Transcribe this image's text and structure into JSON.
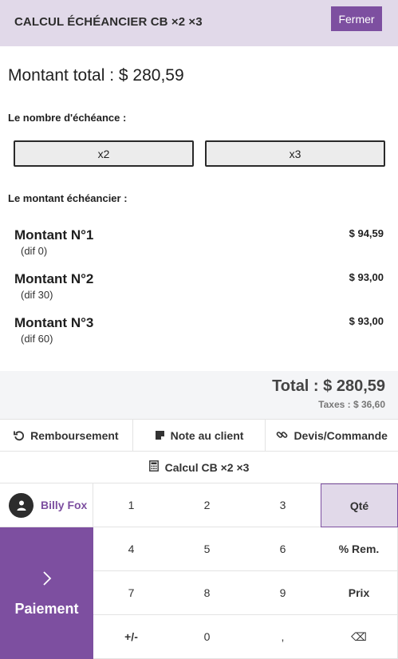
{
  "header": {
    "title": "CALCUL ÉCHÉANCIER CB ×2 ×3",
    "close_label": "Fermer"
  },
  "total_heading": "Montant total : $ 280,59",
  "count_section": {
    "label": "Le nombre d'échéance :",
    "options": [
      "x2",
      "x3"
    ]
  },
  "installments_section": {
    "label": "Le montant échéancier :",
    "items": [
      {
        "title": "Montant N°1",
        "sub": "(dif 0)",
        "amount": "$ 94,59"
      },
      {
        "title": "Montant N°2",
        "sub": "(dif 30)",
        "amount": "$ 93,00"
      },
      {
        "title": "Montant N°3",
        "sub": "(dif 60)",
        "amount": "$ 93,00"
      }
    ]
  },
  "summary": {
    "total": "Total : $ 280,59",
    "taxes": "Taxes : $ 36,60"
  },
  "actions": [
    {
      "label": "Remboursement",
      "icon": "undo-icon"
    },
    {
      "label": "Note au client",
      "icon": "note-icon"
    },
    {
      "label": "Devis/Commande",
      "icon": "link-icon"
    }
  ],
  "calc_button": {
    "label": "Calcul CB ×2 ×3",
    "icon": "calculator-icon"
  },
  "customer": {
    "name": "Billy Fox",
    "icon": "user-icon"
  },
  "payment": {
    "label": "Paiement",
    "icon": "chevron-right-icon"
  },
  "keypad": {
    "rows": [
      [
        "1",
        "2",
        "3",
        "Qté"
      ],
      [
        "4",
        "5",
        "6",
        "% Rem."
      ],
      [
        "7",
        "8",
        "9",
        "Prix"
      ],
      [
        "+/-",
        "0",
        ",",
        "⌫"
      ]
    ],
    "active_mode": "Qté"
  },
  "colors": {
    "accent": "#7d4fa0",
    "header_bg": "#e1d9e9",
    "summary_bg": "#f4f5f7"
  }
}
